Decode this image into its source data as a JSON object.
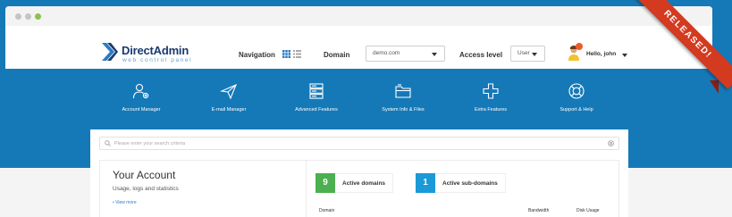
{
  "colors": {
    "background": "#1579b8",
    "ribbon": "#d43a1f",
    "active_domains": "#4caf50",
    "active_subdomains": "#1a9ad6"
  },
  "window": {
    "controls": [
      "close",
      "minimize",
      "maximize"
    ]
  },
  "header": {
    "logo": {
      "name": "DirectAdmin",
      "tagline": "web control panel"
    },
    "navigation_label": "Navigation",
    "view_icons": [
      "grid-icon",
      "list-icon"
    ],
    "domain_label": "Domain",
    "domain_value": "demo.com",
    "access_label": "Access level",
    "access_value": "User",
    "user_greeting": "Hello, john"
  },
  "ribbon": {
    "text": "RELEASED!"
  },
  "features": [
    {
      "label": "Account Manager",
      "icon": "users-gear-icon"
    },
    {
      "label": "E-mail Manager",
      "icon": "paper-plane-icon"
    },
    {
      "label": "Advanced Features",
      "icon": "server-stack-icon"
    },
    {
      "label": "System Info & Files",
      "icon": "folder-icon"
    },
    {
      "label": "Extra Features",
      "icon": "plus-icon"
    },
    {
      "label": "Support & Help",
      "icon": "lifebuoy-icon"
    }
  ],
  "search": {
    "placeholder": "Please enter your search criteria"
  },
  "account": {
    "title": "Your Account",
    "subtitle": "Usage, logs and statistics",
    "link": "• View more"
  },
  "stats": [
    {
      "count": "9",
      "label": "Active domains"
    },
    {
      "count": "1",
      "label": "Active sub-domains"
    }
  ],
  "table": {
    "columns": [
      "Domain",
      "Bandwidth",
      "Disk Usage"
    ]
  }
}
